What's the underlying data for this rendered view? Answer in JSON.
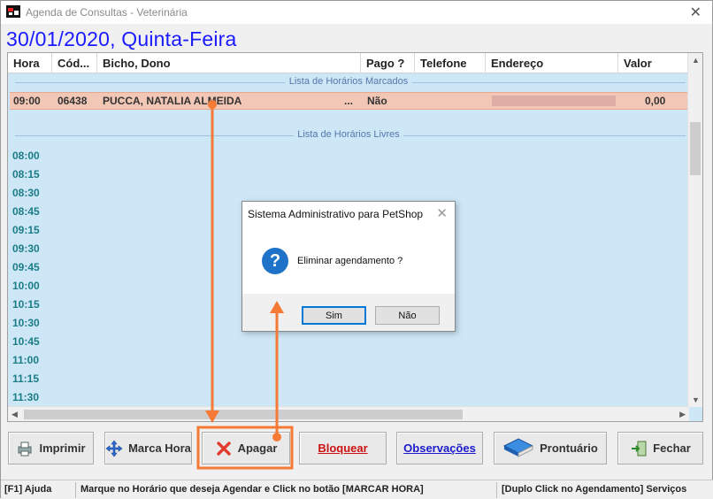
{
  "window": {
    "title": "Agenda de Consultas - Veterinária",
    "close_glyph": "✕"
  },
  "date_title": "30/01/2020, Quinta-Feira",
  "table": {
    "columns": [
      "Hora",
      "Cód...",
      "Bicho, Dono",
      "Pago ?",
      "Telefone",
      "Endereço",
      "Valor"
    ],
    "booked_label": "Lista de Horários Marcados",
    "free_label": "Lista de Horários Livres",
    "booked_rows": [
      {
        "hora": "09:00",
        "codigo": "06438",
        "bicho_dono": "PUCCA, NATALIA ALMEIDA",
        "ellipsis": "...",
        "pago": "Não",
        "telefone": "",
        "valor": "0,00"
      }
    ],
    "free_times": [
      "08:00",
      "08:15",
      "08:30",
      "08:45",
      "09:15",
      "09:30",
      "09:45",
      "10:00",
      "10:15",
      "10:30",
      "10:45",
      "11:00",
      "11:15",
      "11:30"
    ]
  },
  "buttons": {
    "imprimir": "Imprimir",
    "marca_hora": "Marca Hora",
    "apagar": "Apagar",
    "bloquear": "Bloquear",
    "observacoes": "Observações",
    "prontuario": "Prontuário",
    "fechar": "Fechar"
  },
  "status_bar": {
    "help": "[F1] Ajuda",
    "hint": "Marque no Horário que deseja Agendar e Click no botão [MARCAR HORA]",
    "right": "[Duplo Click no Agendamento] Serviços"
  },
  "dialog": {
    "title": "Sistema Administrativo para PetShop",
    "message": "Eliminar agendamento ?",
    "icon_glyph": "?",
    "yes": "Sim",
    "no": "Não"
  },
  "colors": {
    "annotation": "#f47a35",
    "date_title": "#1a1aff",
    "grid_bg": "#cde7f7",
    "booked_row": "#f3c7b6",
    "free_time": "#1b7c86",
    "bloquear": "#cc1111",
    "observacoes": "#1a1acc"
  }
}
